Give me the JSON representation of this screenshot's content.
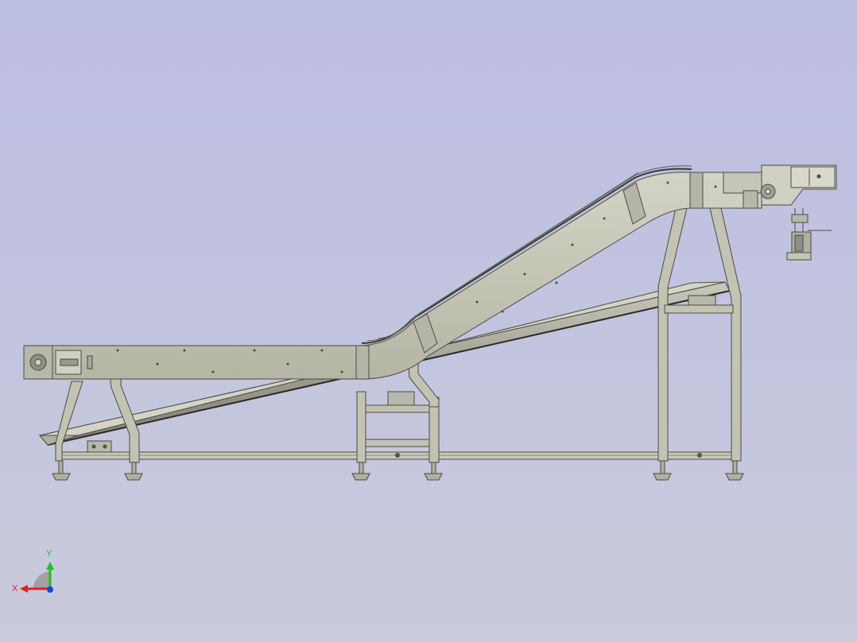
{
  "viewport": {
    "background_top": "#bcbde2",
    "background_bottom": "#c9cbdc"
  },
  "model": {
    "frame_color": "#c3c3b3",
    "frame_edge": "#4a4a44",
    "belt_color": "#bdbdad",
    "tray_color": "#9a9a8c"
  },
  "triad": {
    "x_label": "X",
    "y_label": "Y",
    "x_color": "#e02020",
    "y_color": "#20c020",
    "z_color": "#2040e0"
  }
}
